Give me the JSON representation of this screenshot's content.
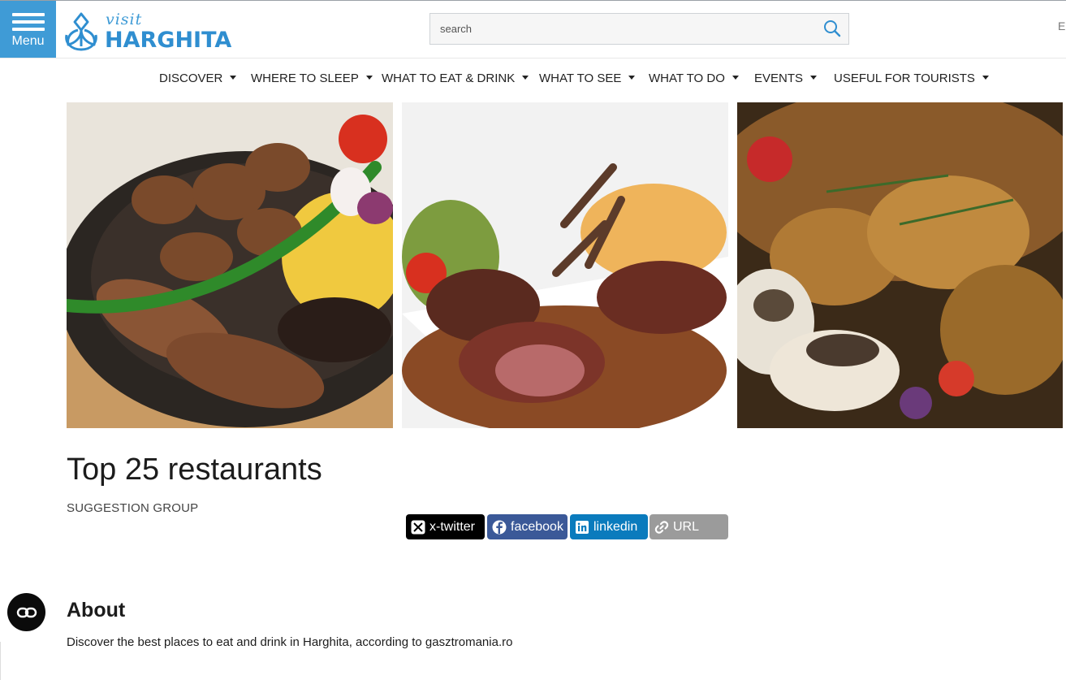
{
  "header": {
    "menu_label": "Menu",
    "logo": {
      "visit": "visit",
      "name": "HARGHITA"
    },
    "search": {
      "placeholder": "search"
    },
    "lang_edge": "E"
  },
  "nav": {
    "items": [
      {
        "label": "DISCOVER"
      },
      {
        "label": "WHERE TO SLEEP"
      },
      {
        "label": "WHAT TO EAT & DRINK"
      },
      {
        "label": "WHAT TO SEE"
      },
      {
        "label": "WHAT TO DO"
      },
      {
        "label": "EVENTS"
      },
      {
        "label": "USEFUL FOR TOURISTS"
      }
    ]
  },
  "gallery": {
    "images": [
      "skillet-sausage-polenta-photo",
      "lamb-rack-plate-photo",
      "grilled-chicken-mushrooms-photo"
    ]
  },
  "main": {
    "title": "Top 25 restaurants",
    "subtitle": "SUGGESTION GROUP",
    "share": {
      "twitter": "x-twitter",
      "facebook": "facebook",
      "linkedin": "linkedin",
      "url": "URL"
    },
    "about_heading": "About",
    "about_text": "Discover the best places to eat and drink in Harghita, according to gasztromania.ro"
  },
  "colors": {
    "brand_blue": "#3f9bd6",
    "facebook": "#3b5998",
    "linkedin": "#0a7bbd",
    "twitter": "#000000",
    "url": "#9b9b9b"
  }
}
